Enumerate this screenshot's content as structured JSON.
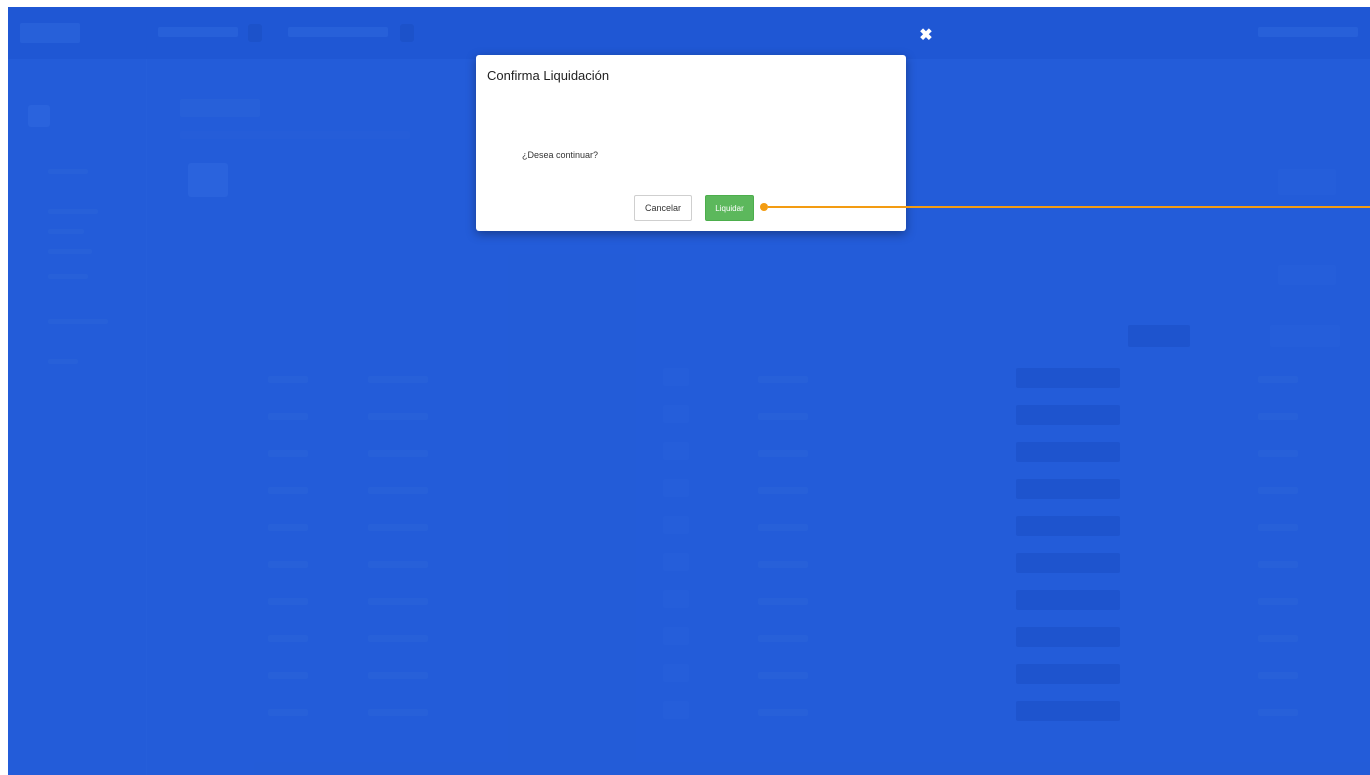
{
  "modal": {
    "title": "Confirma Liquidación",
    "message": "¿Desea continuar?",
    "cancel_label": "Cancelar",
    "confirm_label": "Liquidar",
    "close_glyph": "✖"
  },
  "colors": {
    "overlay": "#1e5adc",
    "confirm_button": "#5cb85c",
    "callout": "#f39c12"
  },
  "icons": {
    "close": "close-icon"
  }
}
